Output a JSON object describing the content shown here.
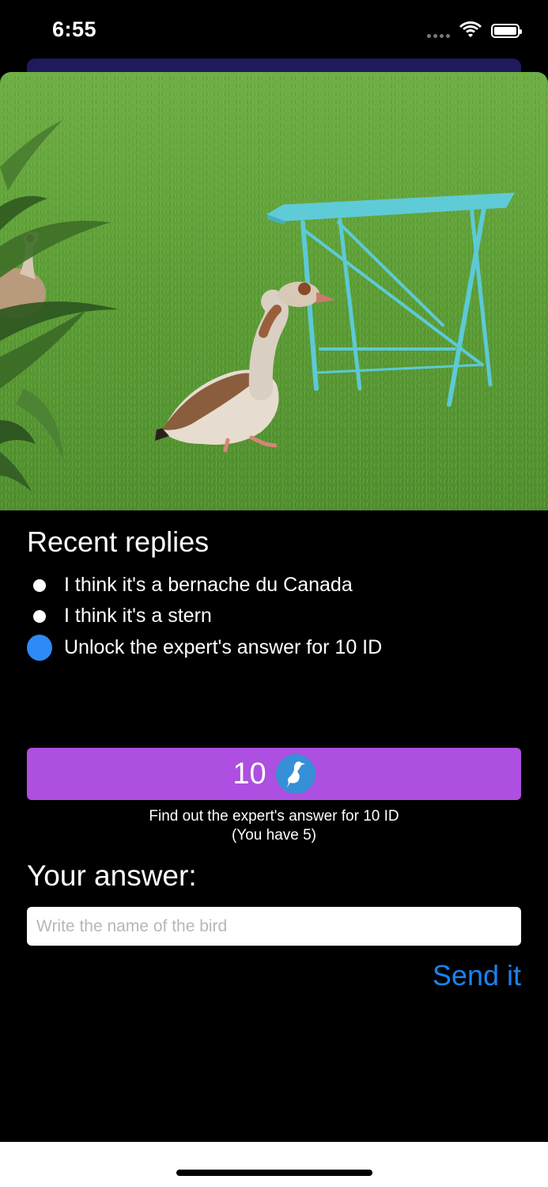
{
  "status_bar": {
    "time": "6:55",
    "icons": [
      "signal-dots-icon",
      "wifi-icon",
      "battery-icon"
    ]
  },
  "photo": {
    "subject": "goose-on-lawn-photo",
    "colors": {
      "grass": "#5d9a38",
      "table": "#5fc9d6"
    }
  },
  "replies": {
    "title": "Recent replies",
    "items": [
      "I think it's a bernache du Canada",
      "I think it's a stern"
    ],
    "unlock_label": "Unlock the expert's answer for 10 ID"
  },
  "unlock": {
    "cost": "10",
    "icon": "heron-icon",
    "caption_line1": "Find out the expert's answer for 10 ID",
    "caption_line2": "(You have 5)",
    "color": "#ad4fe0"
  },
  "answer": {
    "title": "Your answer:",
    "placeholder": "Write the name of the bird",
    "value": "",
    "send_label": "Send it",
    "send_color": "#1a82f0"
  }
}
